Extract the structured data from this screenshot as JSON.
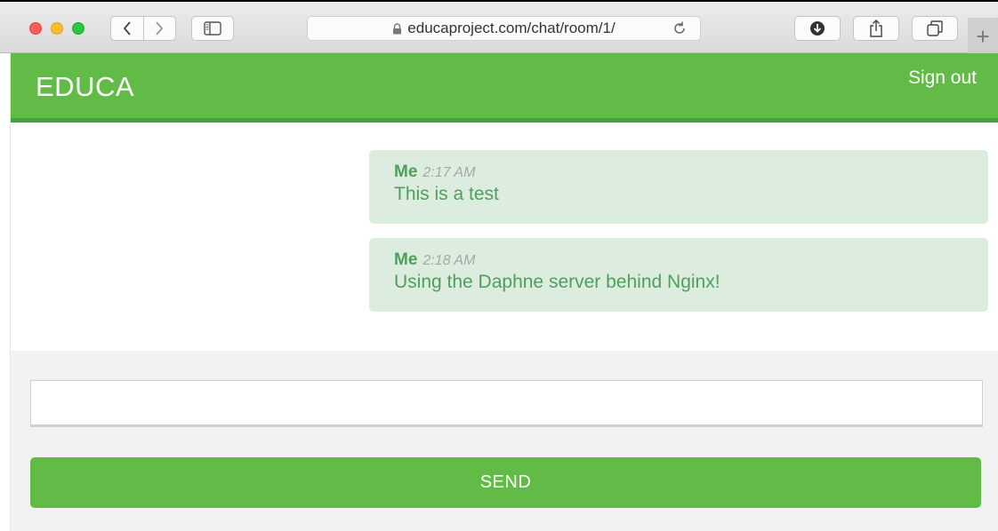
{
  "browser": {
    "url": "educaproject.com/chat/room/1/",
    "new_tab_label": "+"
  },
  "app": {
    "brand": "EDUCA",
    "sign_out": "Sign out"
  },
  "messages": [
    {
      "sender": "Me",
      "time": "2:17 AM",
      "text": "This is a test"
    },
    {
      "sender": "Me",
      "time": "2:18 AM",
      "text": "Using the Daphne server behind Nginx!"
    }
  ],
  "composer": {
    "value": "",
    "send_label": "SEND"
  },
  "colors": {
    "brand_green": "#63bb47",
    "message_bg": "#dcede0",
    "message_text": "#4f9f5b"
  }
}
